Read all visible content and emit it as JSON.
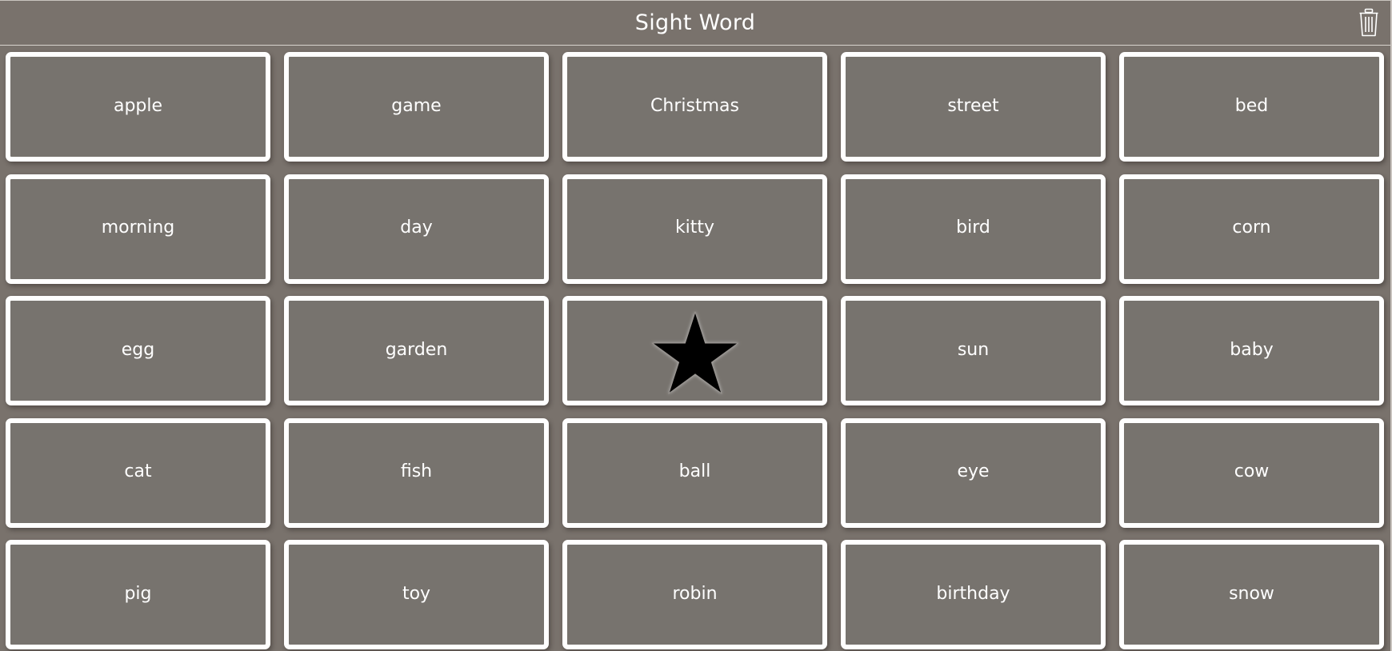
{
  "header": {
    "title": "Sight Word",
    "trash_icon": "trash-icon"
  },
  "board": {
    "free_space_icon": "star-icon",
    "tiles": [
      {
        "label": "apple"
      },
      {
        "label": "game"
      },
      {
        "label": "Christmas"
      },
      {
        "label": "street"
      },
      {
        "label": "bed"
      },
      {
        "label": "morning"
      },
      {
        "label": "day"
      },
      {
        "label": "kitty"
      },
      {
        "label": "bird"
      },
      {
        "label": "corn"
      },
      {
        "label": "egg"
      },
      {
        "label": "garden"
      },
      {
        "label": null,
        "icon": "star-icon"
      },
      {
        "label": "sun"
      },
      {
        "label": "baby"
      },
      {
        "label": "cat"
      },
      {
        "label": "fish"
      },
      {
        "label": "ball"
      },
      {
        "label": "eye"
      },
      {
        "label": "cow"
      },
      {
        "label": "pig"
      },
      {
        "label": "toy"
      },
      {
        "label": "robin"
      },
      {
        "label": "birthday"
      },
      {
        "label": "snow"
      }
    ]
  },
  "colors": {
    "background": "#79726c",
    "tile_fill": "#77736e",
    "tile_border": "#ffffff",
    "text": "#ffffff",
    "star": "#000000"
  }
}
